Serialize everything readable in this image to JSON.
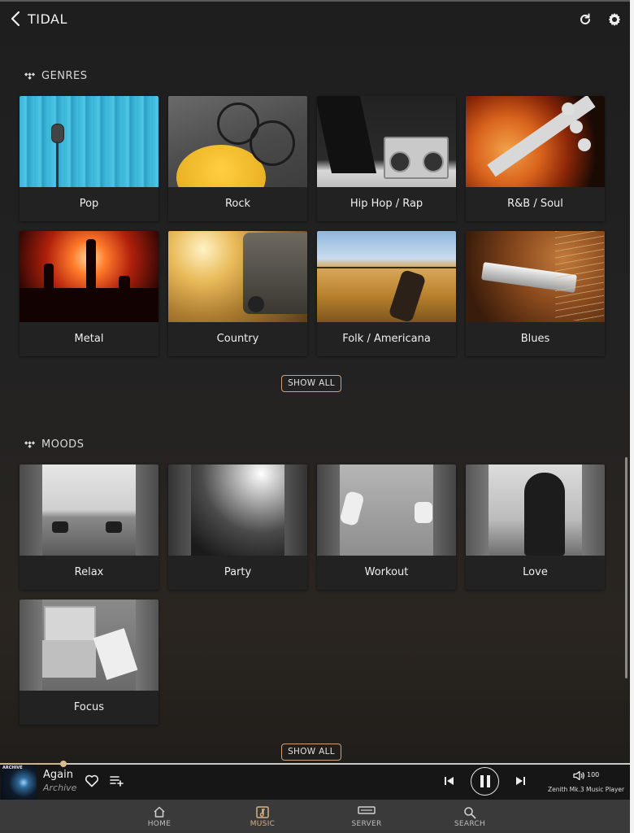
{
  "header": {
    "title": "TIDAL"
  },
  "genres": {
    "label": "GENRES",
    "items": [
      {
        "label": "Pop"
      },
      {
        "label": "Rock"
      },
      {
        "label": "Hip Hop / Rap"
      },
      {
        "label": "R&B / Soul"
      },
      {
        "label": "Metal"
      },
      {
        "label": "Country"
      },
      {
        "label": "Folk / Americana"
      },
      {
        "label": "Blues"
      }
    ],
    "show_all": "SHOW ALL"
  },
  "moods": {
    "label": "MOODS",
    "items": [
      {
        "label": "Relax"
      },
      {
        "label": "Party"
      },
      {
        "label": "Workout"
      },
      {
        "label": "Love"
      },
      {
        "label": "Focus"
      }
    ],
    "show_all": "SHOW ALL"
  },
  "player": {
    "art_label": "ARCHIVE",
    "track": "Again",
    "artist": "Archive",
    "volume": "100",
    "device": "Zenith Mk.3 Music Player",
    "progress_fraction": 0.1
  },
  "nav": {
    "items": [
      {
        "label": "HOME"
      },
      {
        "label": "MUSIC"
      },
      {
        "label": "SERVER"
      },
      {
        "label": "SEARCH"
      }
    ],
    "active": "MUSIC"
  },
  "colors": {
    "accent": "#d4b186",
    "background": "#1e1e1e"
  }
}
